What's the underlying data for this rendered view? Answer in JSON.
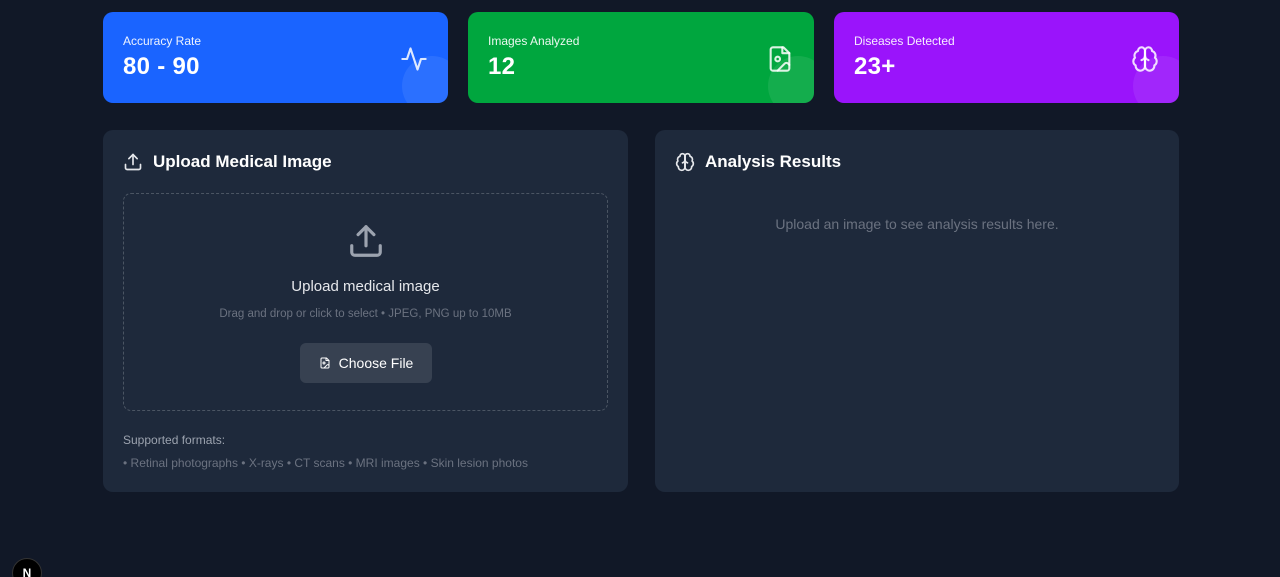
{
  "stats": [
    {
      "label": "Accuracy Rate",
      "value": "80 - 90",
      "icon": "activity-icon",
      "color": "#1a64ff"
    },
    {
      "label": "Images Analyzed",
      "value": "12",
      "icon": "file-image-icon",
      "color": "#00a63e"
    },
    {
      "label": "Diseases Detected",
      "value": "23+",
      "icon": "brain-icon",
      "color": "#9a14fb"
    }
  ],
  "upload_panel": {
    "title": "Upload Medical Image",
    "dropzone_title": "Upload medical image",
    "dropzone_subtitle": "Drag and drop or click to select • JPEG, PNG up to 10MB",
    "button_label": "Choose File",
    "formats_title": "Supported formats:",
    "formats_list": "• Retinal photographs • X-rays • CT scans • MRI images • Skin lesion photos"
  },
  "results_panel": {
    "title": "Analysis Results",
    "placeholder": "Upload an image to see analysis results here."
  },
  "dev_badge": {
    "letter": "N"
  }
}
